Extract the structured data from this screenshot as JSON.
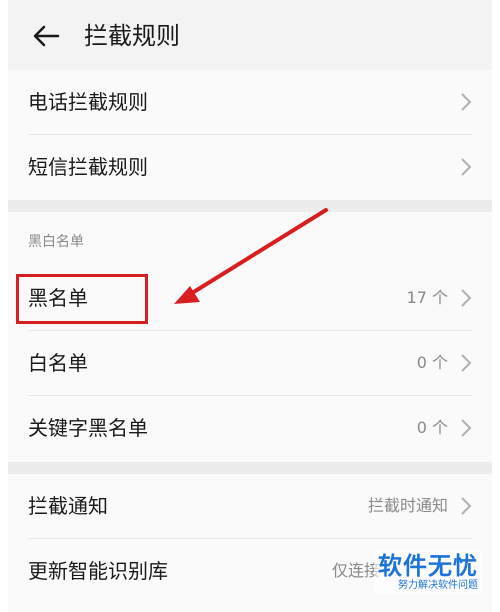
{
  "header": {
    "title": "拦截规则"
  },
  "rows": {
    "call_rules": {
      "label": "电话拦截规则"
    },
    "sms_rules": {
      "label": "短信拦截规则"
    },
    "blacklist": {
      "label": "黑名单",
      "value": "17 个"
    },
    "whitelist": {
      "label": "白名单",
      "value": "0 个"
    },
    "keyword_blacklist": {
      "label": "关键字黑名单",
      "value": "0 个"
    },
    "block_notify": {
      "label": "拦截通知",
      "value": "拦截时通知"
    },
    "update_library": {
      "label": "更新智能识别库",
      "value": "仅连接"
    }
  },
  "section": {
    "title": "黑白名单"
  },
  "watermark": {
    "main": "软件无忧",
    "sub": "努力解决软件问题"
  },
  "colors": {
    "highlight": "#d81e1e",
    "watermark": "#1e73d8"
  }
}
